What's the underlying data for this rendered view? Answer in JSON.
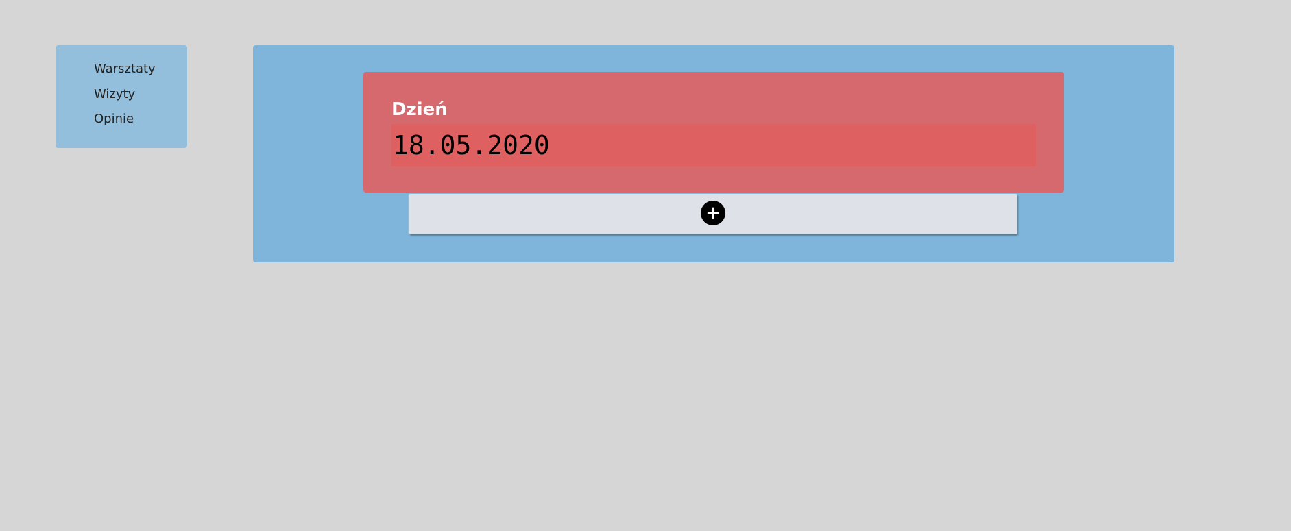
{
  "sidebar": {
    "items": [
      {
        "label": "Warsztaty"
      },
      {
        "label": "Wizyty"
      },
      {
        "label": "Opinie"
      }
    ]
  },
  "day_card": {
    "label": "Dzień",
    "date_value": "18.05.2020"
  },
  "add_button": {
    "icon": "plus-icon",
    "glyph": "+"
  },
  "colors": {
    "background": "#d6d6d6",
    "sidebar": "#93bfdc",
    "main_panel": "#7fb5da",
    "card": "#d5696d",
    "field": "#df6060",
    "add_bar": "#dfe1e8"
  }
}
